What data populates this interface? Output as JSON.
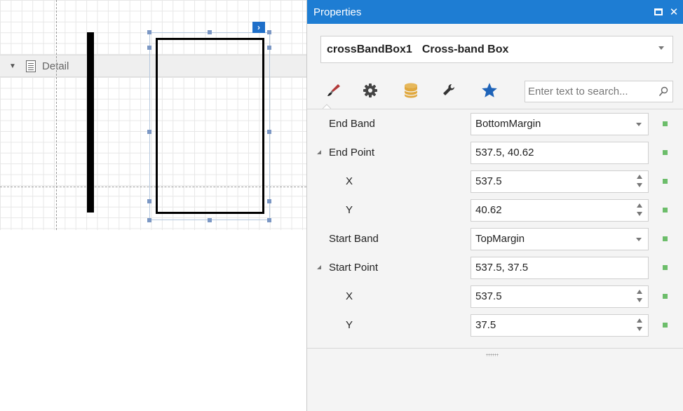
{
  "designer": {
    "band_label": "Detail"
  },
  "properties": {
    "title": "Properties",
    "object_selector": {
      "name": "crossBandBox1",
      "type": "Cross-band Box"
    },
    "toolbar": {
      "tabs": [
        "appearance-brush-icon",
        "behavior-gear-icon",
        "data-database-icon",
        "layout-wrench-icon",
        "favorites-star-icon"
      ],
      "search_placeholder": "Enter text to search..."
    },
    "rows": [
      {
        "name": "End Band",
        "value": "BottomMargin",
        "editor": "dropdown",
        "expandable": false,
        "child": false
      },
      {
        "name": "End Point",
        "value": "537.5, 40.62",
        "editor": "text",
        "expandable": true,
        "child": false
      },
      {
        "name": "X",
        "value": "537.5",
        "editor": "spin",
        "expandable": false,
        "child": true
      },
      {
        "name": "Y",
        "value": "40.62",
        "editor": "spin",
        "expandable": false,
        "child": true
      },
      {
        "name": "Start Band",
        "value": "TopMargin",
        "editor": "dropdown",
        "expandable": false,
        "child": false
      },
      {
        "name": "Start Point",
        "value": "537.5, 37.5",
        "editor": "text",
        "expandable": true,
        "child": false
      },
      {
        "name": "X",
        "value": "537.5",
        "editor": "spin",
        "expandable": false,
        "child": true
      },
      {
        "name": "Y",
        "value": "37.5",
        "editor": "spin",
        "expandable": false,
        "child": true
      }
    ]
  },
  "colors": {
    "accent": "#1e7dd3",
    "marker": "#6cbd6a",
    "selection_handle": "#7b97c4"
  }
}
